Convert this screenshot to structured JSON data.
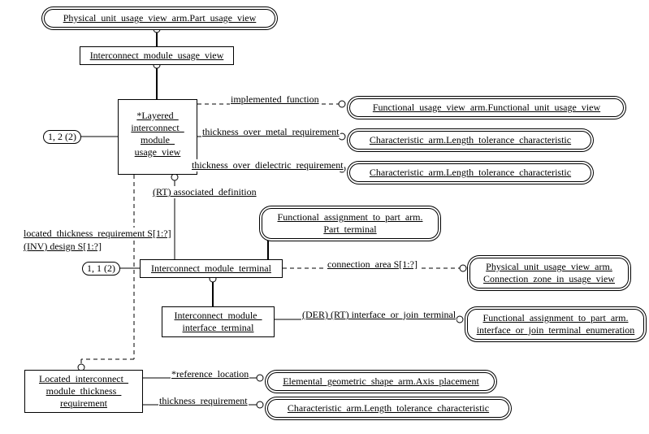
{
  "nodes": {
    "n_physunit": "Physical_unit_usage_view_arm.Part_usage_view",
    "n_imuv": "Interconnect_module_usage_view",
    "n_limuv_l1": "*Layered_",
    "n_limuv_l2": "interconnect_",
    "n_limuv_l3": "module_",
    "n_limuv_l4": "usage_view",
    "n_fuv": "Functional_usage_view_arm.Functional_unit_usage_view",
    "n_char1": "Characteristic_arm.Length_tolerance_characteristic",
    "n_char2": "Characteristic_arm.Length_tolerance_characteristic",
    "n_fapt_l1": "Functional_assignment_to_part_arm.",
    "n_fapt_l2": "Part_terminal",
    "n_imt": "Interconnect_module_terminal",
    "n_puv_l1": "Physical_unit_usage_view_arm.",
    "n_puv_l2": "Connection_zone_in_usage_view",
    "n_imit_l1": "Interconnect_module_",
    "n_imit_l2": "interface_terminal",
    "n_ioj_l1": "Functional_assignment_to_part_arm.",
    "n_ioj_l2": "interface_or_join_terminal_enumeration",
    "n_litr_l1": "Located_interconnect_",
    "n_litr_l2": "module_thickness_",
    "n_litr_l3": "requirement",
    "n_egs": "Elemental_geometric_shape_arm.Axis_placement",
    "n_char3": "Characteristic_arm.Length_tolerance_characteristic"
  },
  "labels": {
    "l_impfunc": "implemented_function",
    "l_tom": "thickness_over_metal_requirement",
    "l_tod": "thickness_over_dielectric_requirement",
    "l_assoc": "(RT) associated_definition",
    "l_ltr": "located_thickness_requirement S[1:?]",
    "l_inv": "(INV) design S[1:?]",
    "l_connarea": "connection_area S[1:?]",
    "l_derrt": "(DER) (RT) interface_or_join_terminal",
    "l_refloc": "*reference_location",
    "l_tr": "thickness_requirement"
  },
  "links": {
    "pl_12_2a": "1, 2 (2)",
    "pl_11_2": "1, 1 (2)"
  },
  "chart_data": {
    "type": "diagram",
    "title": "",
    "notation": "EXPRESS-G",
    "entities": [
      {
        "name": "Physical_unit_usage_view_arm.Part_usage_view",
        "external": true
      },
      {
        "name": "Interconnect_module_usage_view"
      },
      {
        "name": "Layered_interconnect_module_usage_view",
        "marked": "*"
      },
      {
        "name": "Functional_usage_view_arm.Functional_unit_usage_view",
        "external": true
      },
      {
        "name": "Characteristic_arm.Length_tolerance_characteristic",
        "external": true,
        "uses": 3
      },
      {
        "name": "Functional_assignment_to_part_arm.Part_terminal",
        "external": true
      },
      {
        "name": "Interconnect_module_terminal"
      },
      {
        "name": "Physical_unit_usage_view_arm.Connection_zone_in_usage_view",
        "external": true
      },
      {
        "name": "Interconnect_module_interface_terminal"
      },
      {
        "name": "Functional_assignment_to_part_arm.interface_or_join_terminal_enumeration",
        "external": true
      },
      {
        "name": "Located_interconnect_module_thickness_requirement"
      },
      {
        "name": "Elemental_geometric_shape_arm.Axis_placement",
        "external": true
      }
    ],
    "relationships": [
      {
        "from": "Interconnect_module_usage_view",
        "to": "Physical_unit_usage_view_arm.Part_usage_view",
        "kind": "supertype"
      },
      {
        "from": "Layered_interconnect_module_usage_view",
        "to": "Interconnect_module_usage_view",
        "kind": "supertype"
      },
      {
        "from": "Layered_interconnect_module_usage_view",
        "to": "Functional_usage_view_arm.Functional_unit_usage_view",
        "role": "implemented_function",
        "style": "dashed"
      },
      {
        "from": "Layered_interconnect_module_usage_view",
        "to": "Characteristic_arm.Length_tolerance_characteristic",
        "role": "thickness_over_metal_requirement",
        "style": "dashed"
      },
      {
        "from": "Layered_interconnect_module_usage_view",
        "to": "Characteristic_arm.Length_tolerance_characteristic",
        "role": "thickness_over_dielectric_requirement",
        "style": "dashed"
      },
      {
        "from": "Interconnect_module_terminal",
        "to": "Layered_interconnect_module_usage_view",
        "role": "(RT) associated_definition"
      },
      {
        "from": "Layered_interconnect_module_usage_view",
        "to": "Located_interconnect_module_thickness_requirement",
        "role": "located_thickness_requirement S[1:?]",
        "inverse": "(INV) design S[1:?]",
        "style": "dashed"
      },
      {
        "from": "Interconnect_module_terminal",
        "to": "Functional_assignment_to_part_arm.Part_terminal",
        "kind": "supertype"
      },
      {
        "from": "Interconnect_module_terminal",
        "to": "Physical_unit_usage_view_arm.Connection_zone_in_usage_view",
        "role": "connection_area S[1:?]",
        "style": "dashed"
      },
      {
        "from": "Interconnect_module_interface_terminal",
        "to": "Interconnect_module_terminal",
        "kind": "supertype"
      },
      {
        "from": "Interconnect_module_interface_terminal",
        "to": "Functional_assignment_to_part_arm.interface_or_join_terminal_enumeration",
        "role": "(DER) (RT) interface_or_join_terminal"
      },
      {
        "from": "Located_interconnect_module_thickness_requirement",
        "to": "Elemental_geometric_shape_arm.Axis_placement",
        "role": "*reference_location"
      },
      {
        "from": "Located_interconnect_module_thickness_requirement",
        "to": "Characteristic_arm.Length_tolerance_characteristic",
        "role": "thickness_requirement"
      }
    ],
    "page_references": [
      {
        "text": "1, 2 (2)",
        "attached_to": "Layered_interconnect_module_usage_view"
      },
      {
        "text": "1, 1 (2)",
        "attached_to": "Interconnect_module_terminal"
      }
    ]
  }
}
